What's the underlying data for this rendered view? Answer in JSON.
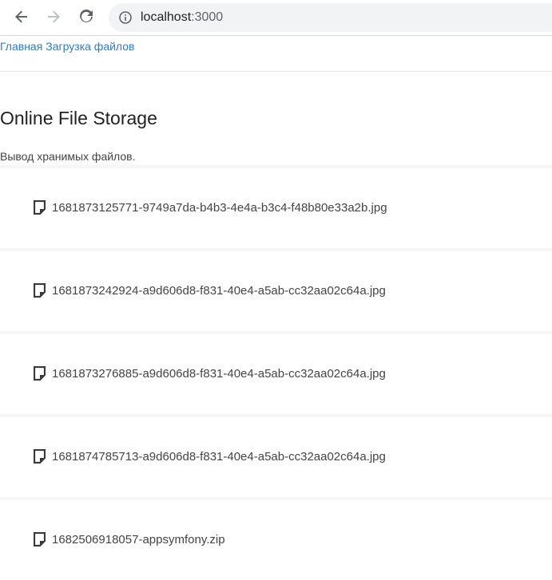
{
  "browser": {
    "url_host": "localhost",
    "url_port": ":3000",
    "back_icon": "arrow-left-icon",
    "forward_icon": "arrow-right-icon",
    "reload_icon": "reload-icon",
    "info_icon": "info-icon"
  },
  "nav": {
    "home_label": "Главная",
    "upload_label": "Загрузка файлов"
  },
  "main": {
    "title": "Online File Storage",
    "subtitle": "Вывод хранимых файлов.",
    "files": [
      {
        "name": "1681873125771-9749a7da-b4b3-4e4a-b3c4-f48b80e33a2b.jpg",
        "icon": "file-icon"
      },
      {
        "name": "1681873242924-a9d606d8-f831-40e4-a5ab-cc32aa02c64a.jpg",
        "icon": "file-icon"
      },
      {
        "name": "1681873276885-a9d606d8-f831-40e4-a5ab-cc32aa02c64a.jpg",
        "icon": "file-icon"
      },
      {
        "name": "1681874785713-a9d606d8-f831-40e4-a5ab-cc32aa02c64a.jpg",
        "icon": "file-icon"
      },
      {
        "name": "1682506918057-appsymfony.zip",
        "icon": "file-icon"
      }
    ]
  },
  "colors": {
    "link": "#2a7ae2",
    "omnibox_bg": "#f1f3f4"
  }
}
